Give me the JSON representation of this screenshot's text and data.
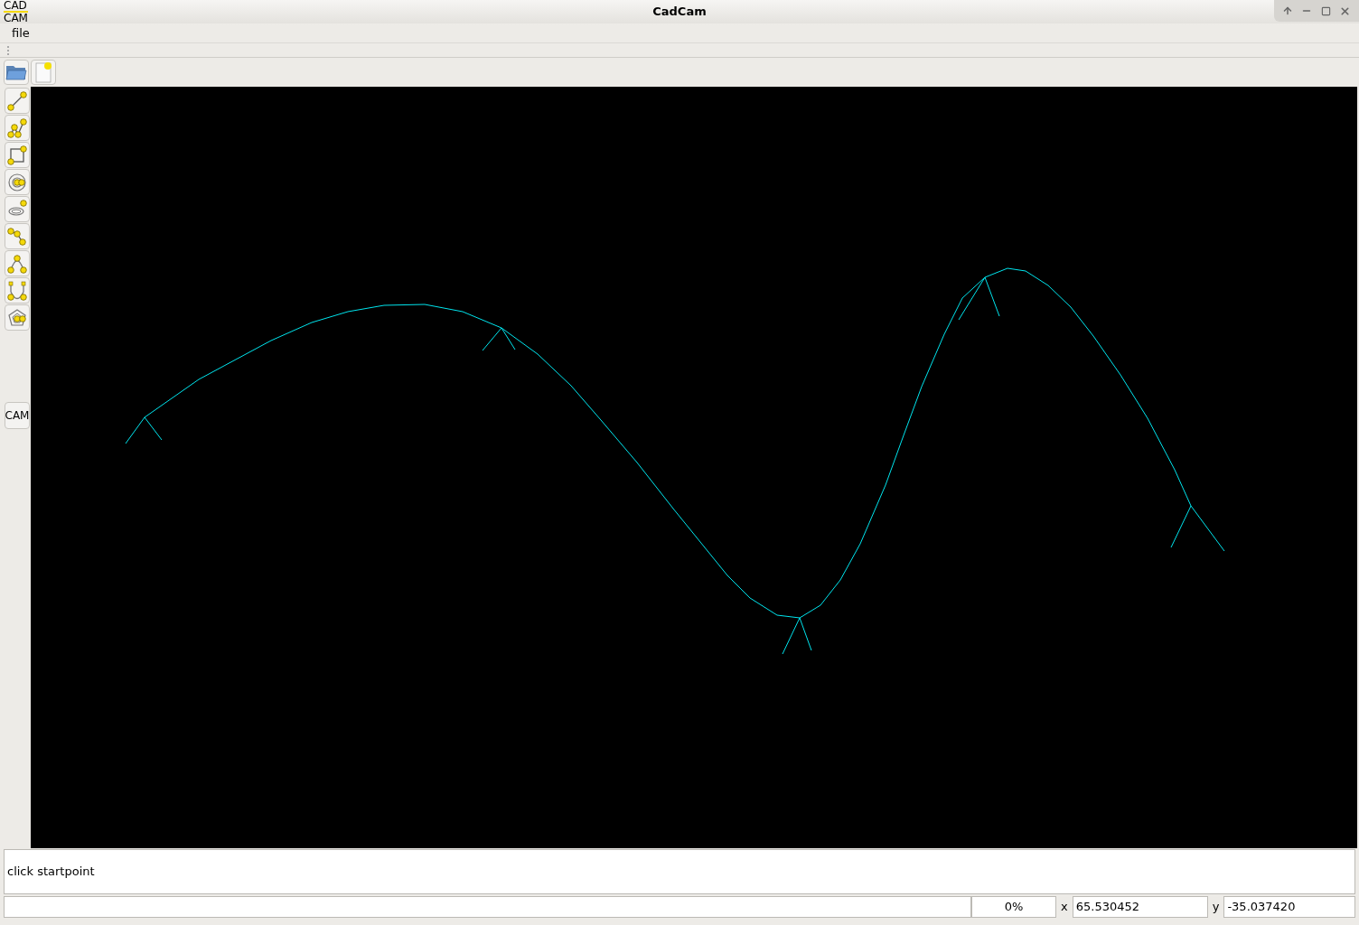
{
  "window": {
    "title": "CadCam",
    "app_icon": [
      "CAD",
      "CAM"
    ]
  },
  "menu": [
    "file"
  ],
  "side_toolbar": {
    "cam_button": "CAM"
  },
  "message": "click startpoint",
  "status_bar": {
    "progress": {
      "level": 0,
      "text": "0%"
    },
    "x": {
      "label": "x",
      "value": "65.530452"
    },
    "y": {
      "label": "y",
      "value": "-35.037420"
    }
  }
}
